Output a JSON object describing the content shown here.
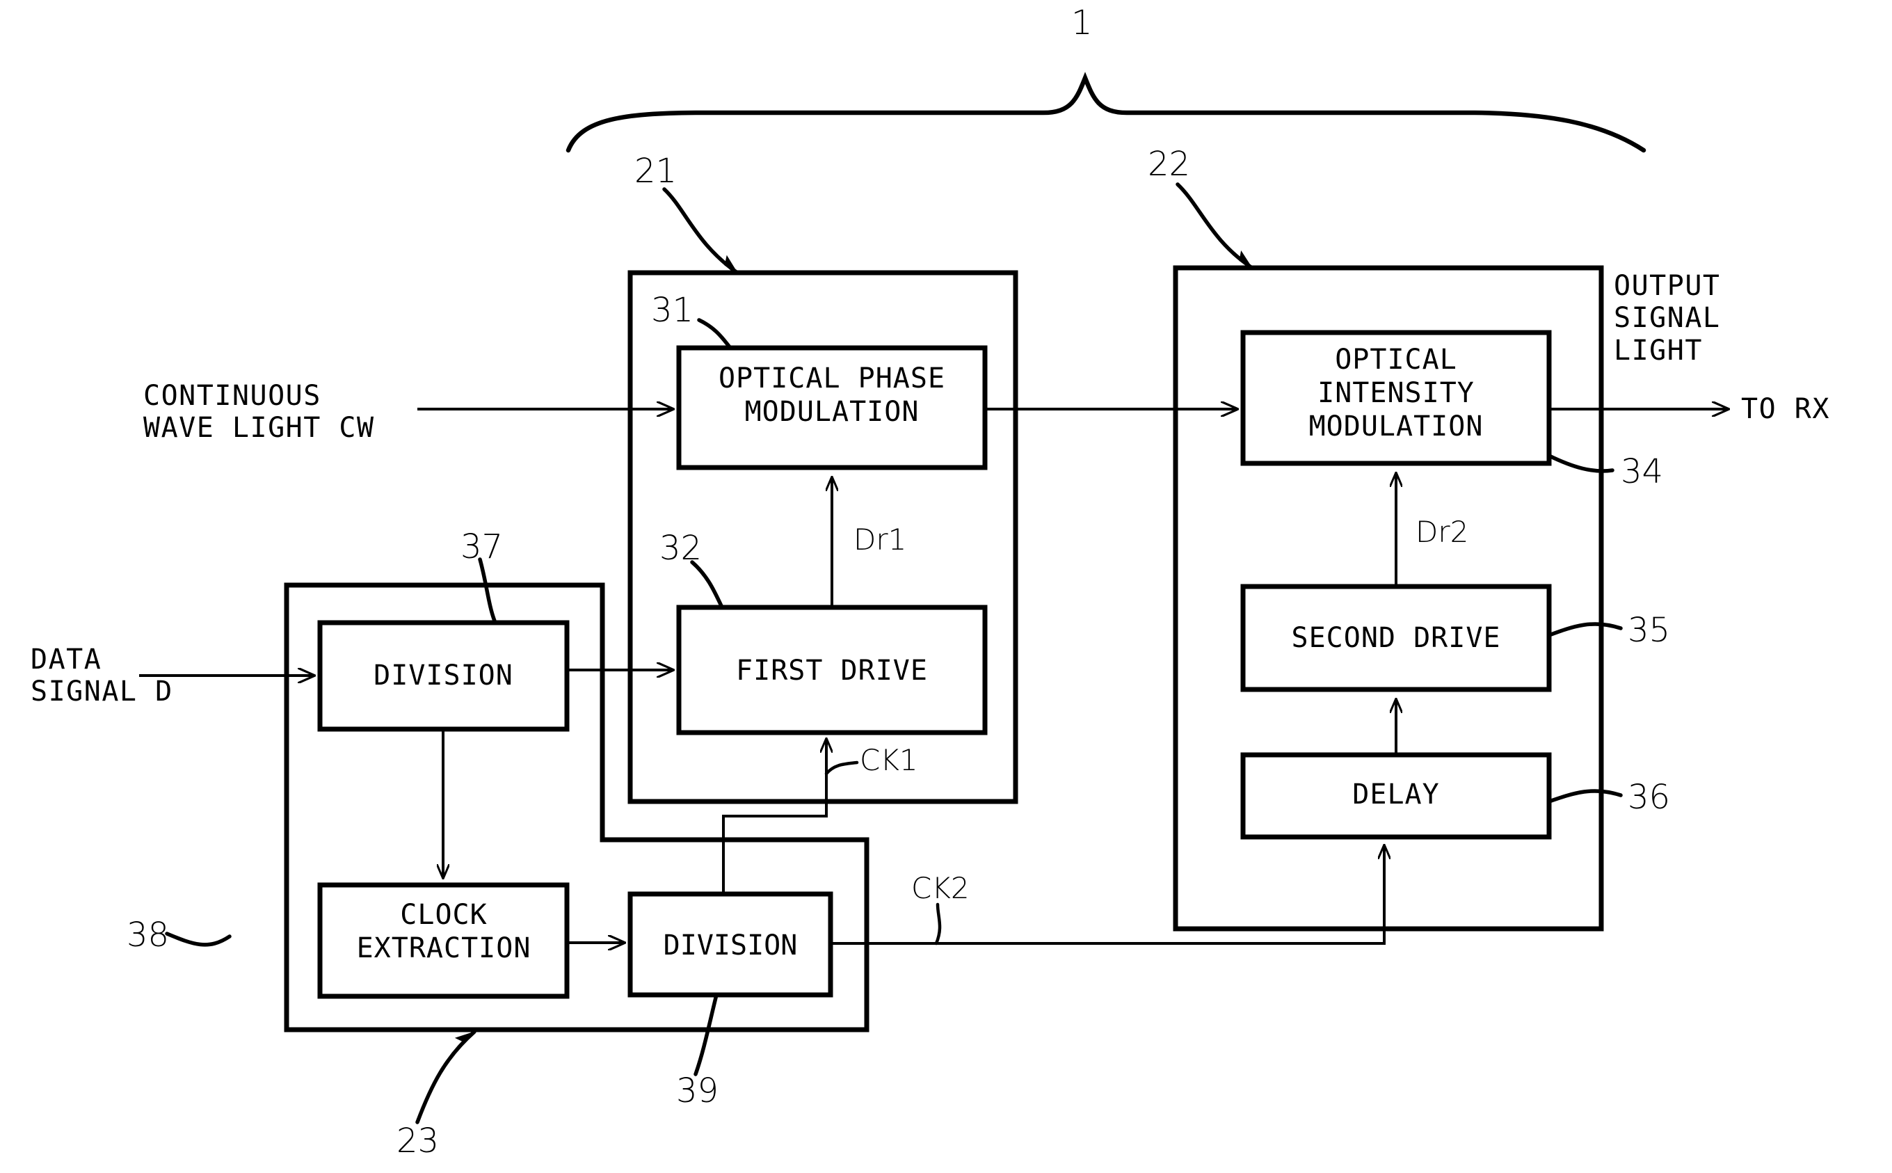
{
  "figure": {
    "type": "patent-block-diagram",
    "title_reference": "1"
  },
  "external_labels": {
    "input_light": "CONTINUOUS\nWAVE LIGHT CW",
    "input_data": "DATA\nSIGNAL D",
    "output_light": "OUTPUT\nSIGNAL\nLIGHT",
    "output_dest": "TO RX"
  },
  "blocks": [
    {
      "id": "b31",
      "label": "OPTICAL PHASE\nMODULATION",
      "ref": "31"
    },
    {
      "id": "b32",
      "label": "FIRST DRIVE",
      "ref": "32"
    },
    {
      "id": "b34",
      "label": "OPTICAL\nINTENSITY\nMODULATION",
      "ref": "34"
    },
    {
      "id": "b35",
      "label": "SECOND DRIVE",
      "ref": "35"
    },
    {
      "id": "b36",
      "label": "DELAY",
      "ref": "36"
    },
    {
      "id": "b37",
      "label": "DIVISION",
      "ref": "37"
    },
    {
      "id": "b38",
      "label": "CLOCK\nEXTRACTION",
      "ref": "38"
    },
    {
      "id": "b39",
      "label": "DIVISION",
      "ref": "39"
    }
  ],
  "groups": [
    {
      "id": "g21",
      "ref": "21"
    },
    {
      "id": "g22",
      "ref": "22"
    },
    {
      "id": "g23",
      "ref": "23"
    }
  ],
  "signals": {
    "dr1": "Dr1",
    "dr2": "Dr2",
    "ck1": "CK1",
    "ck2": "CK2"
  },
  "refs": {
    "r1": "1",
    "r21": "21",
    "r22": "22",
    "r23": "23",
    "r31": "31",
    "r32": "32",
    "r34": "34",
    "r35": "35",
    "r36": "36",
    "r37": "37",
    "r38": "38",
    "r39": "39"
  },
  "colors": {
    "ink": "#000000",
    "paper": "#ffffff"
  }
}
